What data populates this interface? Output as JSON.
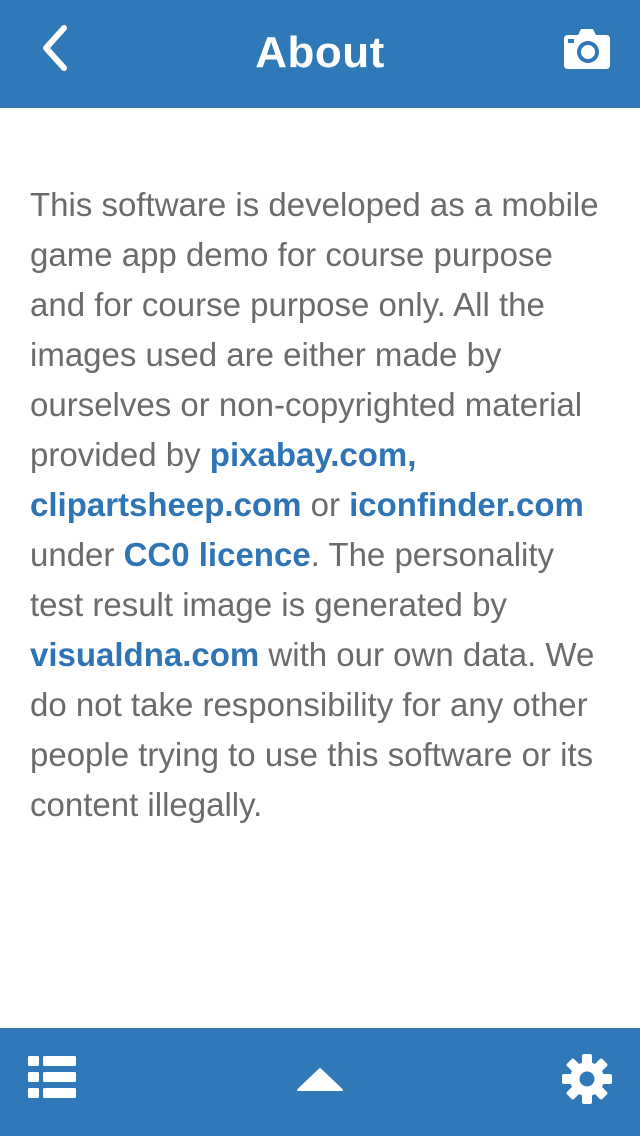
{
  "header": {
    "title": "About",
    "back_icon": "chevron-left-icon",
    "camera_icon": "camera-icon",
    "background_color": "#3079b8"
  },
  "body": {
    "text_color": "#6b6b6b",
    "link_color": "#2f75b5",
    "segments": {
      "s1": "This software is developed as a mobile game app demo for course purpose and for course purpose only. All the images used are either made by ourselves or non-copyrighted material provided by ",
      "link1": "pixabay.com, clipartsheep.com",
      "s2": " or ",
      "link2": "iconfinder.com",
      "s3": " under ",
      "link3": "CC0 licence",
      "s4": ". The personality test result image is generated by ",
      "link4": "visualdna.com",
      "s5": " with our own data. We do not take responsibility for any other people trying to use this software or its content illegally."
    }
  },
  "footer": {
    "menu_icon": "list-icon",
    "up_icon": "caret-up-icon",
    "settings_icon": "gear-icon",
    "background_color": "#3079b8"
  }
}
